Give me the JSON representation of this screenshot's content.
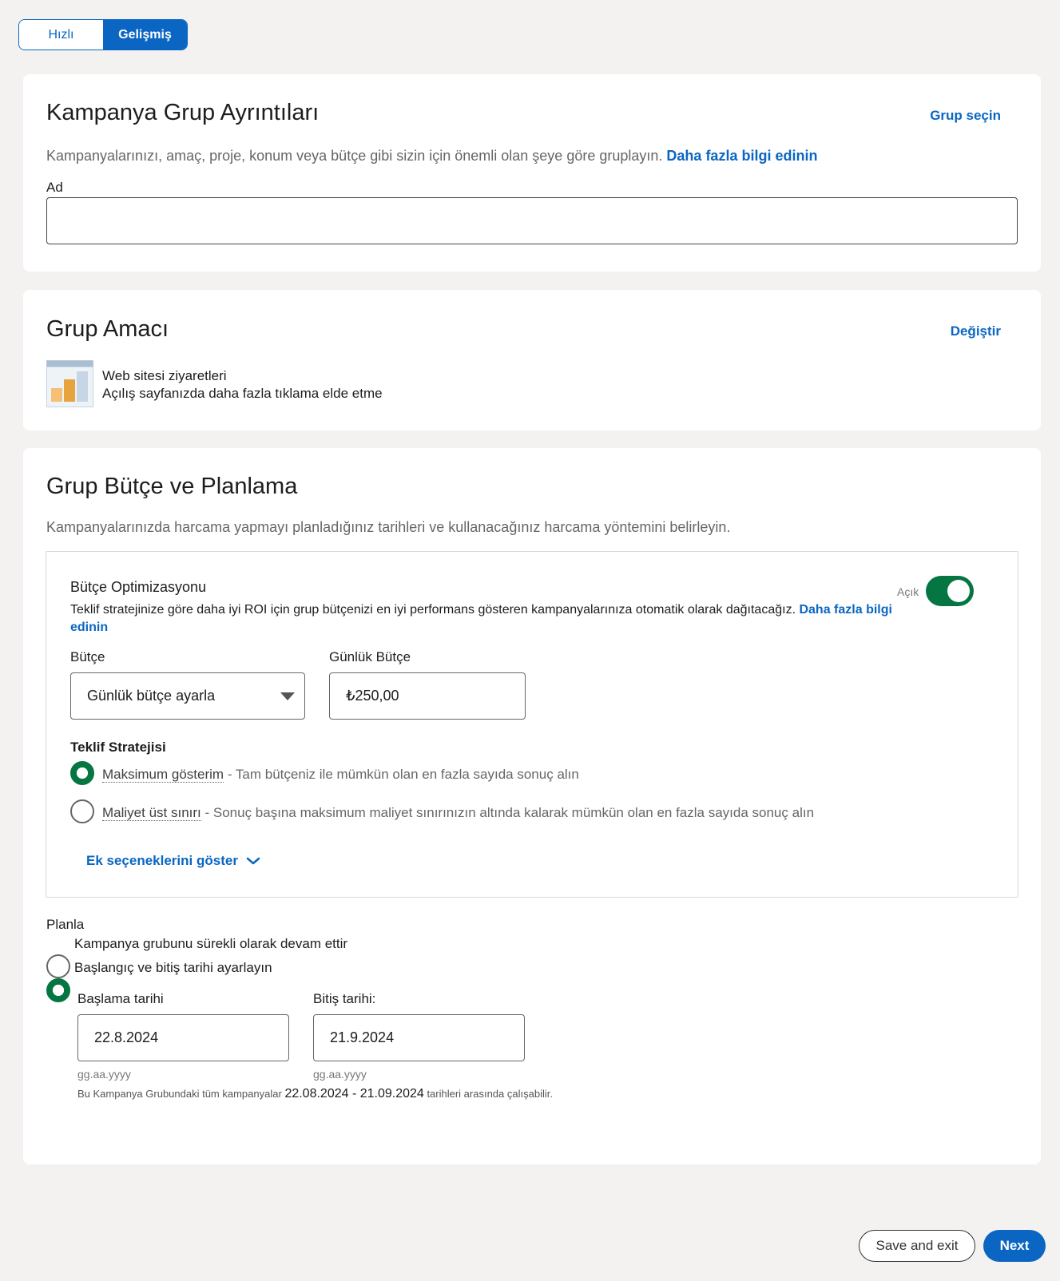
{
  "mode_toggle": {
    "quick": "Hızlı",
    "advanced": "Gelişmiş"
  },
  "details": {
    "title": "Kampanya Grup Ayrıntıları",
    "select_group": "Grup seçin",
    "description": "Kampanyalarınızı, amaç, proje, konum veya bütçe gibi sizin için önemli olan şeye göre gruplayın.",
    "learn_more": "Daha fazla bilgi edinin",
    "name_label": "Ad",
    "name_value": ""
  },
  "objective": {
    "title": "Grup Amacı",
    "change": "Değiştir",
    "name": "Web sitesi ziyaretleri",
    "description": "Açılış sayfanızda daha fazla tıklama elde etme",
    "icon": "bar-chart-icon"
  },
  "budget": {
    "title": "Grup Bütçe ve Planlama",
    "description": "Kampanyalarınızda harcama yapmayı planladığınız tarihleri ve kullanacağınız harcama yöntemini belirleyin.",
    "optimization_title": "Bütçe Optimizasyonu",
    "optimization_desc": "Teklif stratejinize göre daha iyi ROI için grup bütçenizi en iyi performans gösteren kampanyalarınıza otomatik olarak dağıtacağız.",
    "optimization_link_1": "Daha fazla",
    "optimization_link_2": "bilgi edinin",
    "toggle_label": "Açık",
    "budget_label": "Bütçe",
    "budget_select": "Günlük bütçe ayarla",
    "daily_label": "Günlük Bütçe",
    "daily_value": "₺250,00",
    "strategy_label": "Teklif Stratejisi",
    "strategy_max_name": "Maksimum gösterim",
    "strategy_max_desc": " - Tam bütçeniz ile mümkün olan en fazla sayıda sonuç alın",
    "strategy_cap_name": "Maliyet üst sınırı",
    "strategy_cap_desc": " - Sonuç başına maksimum maliyet sınırınızın altında kalarak mümkün olan en fazla sayıda sonuç alın",
    "more_options": "Ek seçeneklerini göster"
  },
  "schedule": {
    "label": "Planla",
    "continuous": "Kampanya grubunu sürekli olarak devam ettir",
    "date_range": "Başlangıç ve bitiş tarihi ayarlayın",
    "start_label": "Başlama tarihi",
    "start_value": "22.8.2024",
    "end_label": "Bitiş tarihi:",
    "end_value": "21.9.2024",
    "format_hint": "gg.aa.yyyy",
    "note_prefix": "Bu Kampanya Grubundaki tüm kampanyalar",
    "note_range": "22.08.2024 - 21.09.2024",
    "note_suffix": "tarihleri arasında çalışabilir."
  },
  "footer": {
    "save_exit": "Save and exit",
    "next": "Next"
  },
  "colors": {
    "accent": "#0a66c2",
    "success": "#057642"
  }
}
